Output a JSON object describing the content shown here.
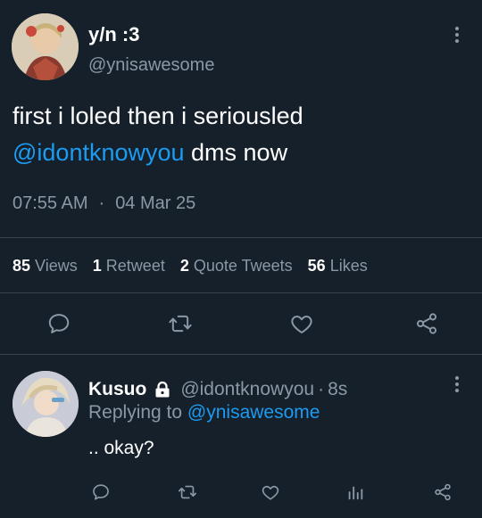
{
  "tweet": {
    "display_name": "y/n :3",
    "handle": "@ynisawesome",
    "text_line1": "first i loled then i seriousled",
    "mention": "@idontknowyou",
    "text_line2_rest": " dms now",
    "time": "07:55 AM",
    "separator": "·",
    "date": "04 Mar 25",
    "stats": {
      "views_num": "85",
      "views_label": "Views",
      "retweets_num": "1",
      "retweets_label": "Retweet",
      "quotes_num": "2",
      "quotes_label": "Quote Tweets",
      "likes_num": "56",
      "likes_label": "Likes"
    },
    "actions": [
      "reply-icon",
      "retweet-icon",
      "like-icon",
      "share-icon"
    ]
  },
  "reply": {
    "display_name": "Kusuo",
    "lock_icon": "lock-icon",
    "handle": "@idontknowyou",
    "separator": "·",
    "time_ago": "8s",
    "replying_label": "Replying to ",
    "replying_handle": "@ynisawesome",
    "text": ".. okay?",
    "actions": [
      "reply-icon",
      "retweet-icon",
      "like-icon",
      "views-icon",
      "share-icon"
    ]
  },
  "colors": {
    "background": "#15202b",
    "text": "#ffffff",
    "muted": "#8b98a5",
    "link": "#1d9bf0",
    "divider": "#38444d"
  }
}
